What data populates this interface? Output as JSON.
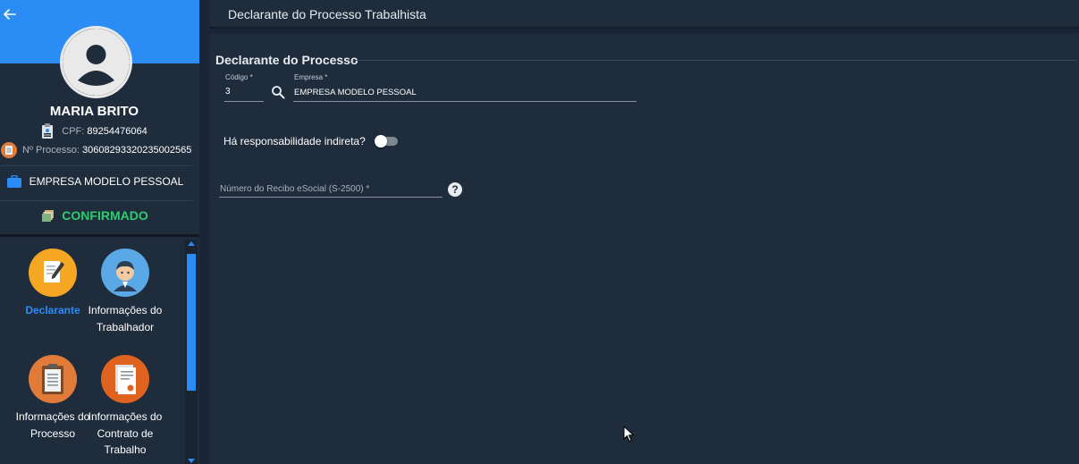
{
  "sidebar": {
    "user": {
      "name": "MARIA BRITO"
    },
    "cpf": {
      "label": "CPF:",
      "value": "89254476064"
    },
    "processo": {
      "label": "Nº Processo:",
      "value": "30608293320235002565"
    },
    "empresa": {
      "name": "EMPRESA MODELO PESSOAL"
    },
    "status": {
      "label": "CONFIRMADO"
    },
    "menu": [
      {
        "label": "Declarante",
        "icon": "document-edit-icon"
      },
      {
        "label": "Informações do Trabalhador",
        "icon": "worker-icon"
      },
      {
        "label": "Informações do Processo",
        "icon": "clipboard-icon"
      },
      {
        "label": "Informações do Contrato de Trabalho",
        "icon": "contract-icon"
      }
    ]
  },
  "header": {
    "title": "Declarante do Processo Trabalhista"
  },
  "form": {
    "section_title": "Declarante do Processo",
    "codigo": {
      "label": "Código *",
      "value": "3"
    },
    "empresa": {
      "label": "Empresa *",
      "value": "EMPRESA MODELO PESSOAL"
    },
    "responsabilidade": {
      "label": "Há responsabilidade indireta?"
    },
    "recibo": {
      "label": "Número do Recibo eSocial (S-2500) *"
    },
    "help": {
      "symbol": "?"
    }
  },
  "colors": {
    "accent": "#2b8cf5",
    "status": "#2ecc71",
    "panel": "#1f2c3c",
    "background": "#1a2636"
  }
}
